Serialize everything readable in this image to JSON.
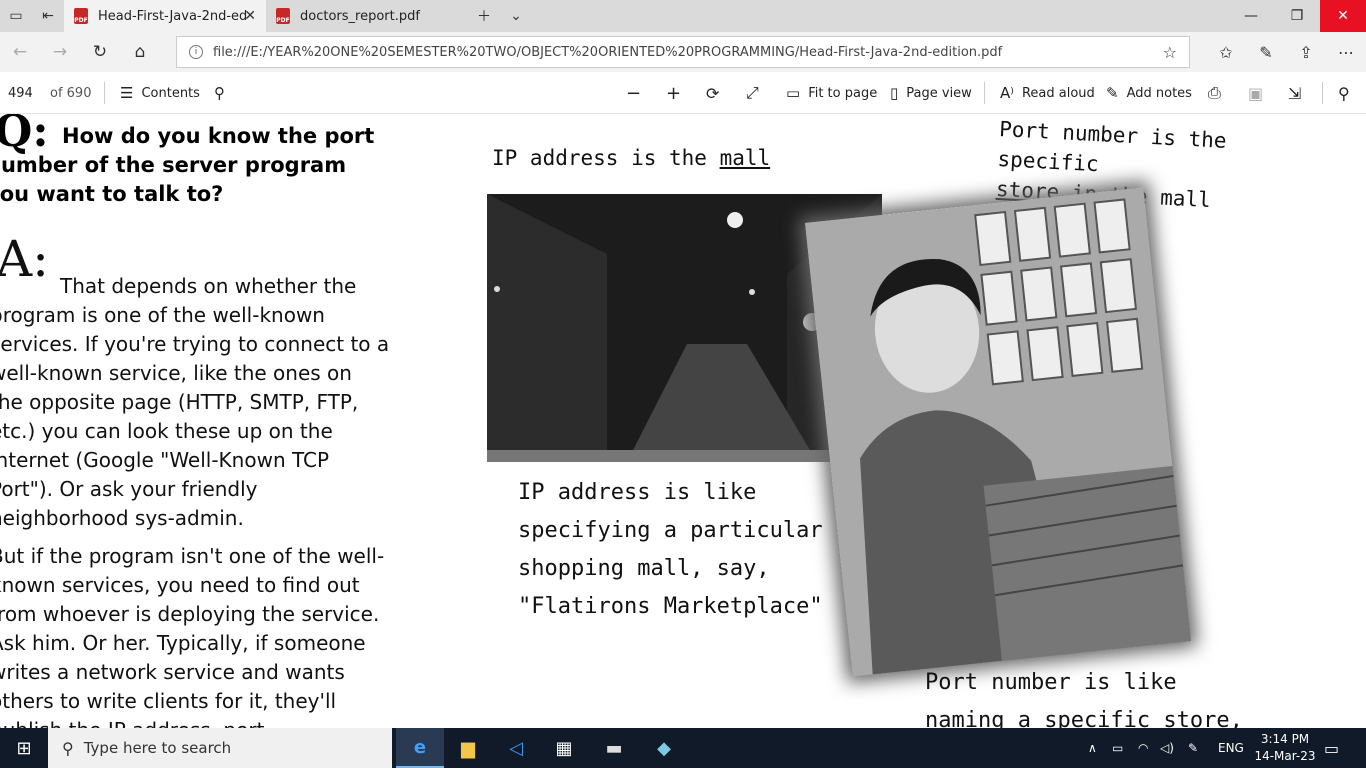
{
  "tabs": [
    {
      "label": "Head-First-Java-2nd-ed",
      "active": true
    },
    {
      "label": "doctors_report.pdf",
      "active": false
    }
  ],
  "address": {
    "url": "file:///E:/YEAR%20ONE%20SEMESTER%20TWO/OBJECT%20ORIENTED%20PROGRAMMING/Head-First-Java-2nd-edition.pdf"
  },
  "pdf_toolbar": {
    "page_number": "494",
    "page_total": "of 690",
    "contents": "Contents",
    "fit_to_page": "Fit to page",
    "page_view": "Page view",
    "read_aloud": "Read aloud",
    "add_notes": "Add notes"
  },
  "content": {
    "q_letter": "Q:",
    "question": "How do you know the port number of the server program you want to talk to?",
    "a_letter": "A:",
    "answer_p1": "That depends on whether the program is one of the well-known services. If you're trying to connect to a well-known service, like the ones on the opposite page (HTTP, SMTP, FTP, etc.) you can look these up on the internet (Google \"Well-Known TCP Port\"). Or ask your friendly neighborhood sys-admin.",
    "answer_p2": "But if the program isn't one of the well-known services, you need to find out from whoever is deploying the service. Ask him. Or her. Typically, if someone writes a network service and wants others to write clients for it, they'll publish the IP address, port",
    "ip_label_pre": "IP address is the ",
    "ip_label_mall": "mall",
    "port_label_line1": "Port number is the specific",
    "port_label_store": "store",
    "port_label_line2_rest": " in the mall",
    "caption_ip": "IP address is like specifying a particular shopping mall, say, \"Flatirons Marketplace\"",
    "caption_port": "Port number is like naming a specific store, say,"
  },
  "taskbar": {
    "search_placeholder": "Type here to search",
    "language": "ENG",
    "time": "3:14 PM",
    "date": "14-Mar-23"
  },
  "colors": {
    "tab_bg": "#dadada",
    "close_red": "#e81123",
    "taskbar": "#101a28"
  }
}
